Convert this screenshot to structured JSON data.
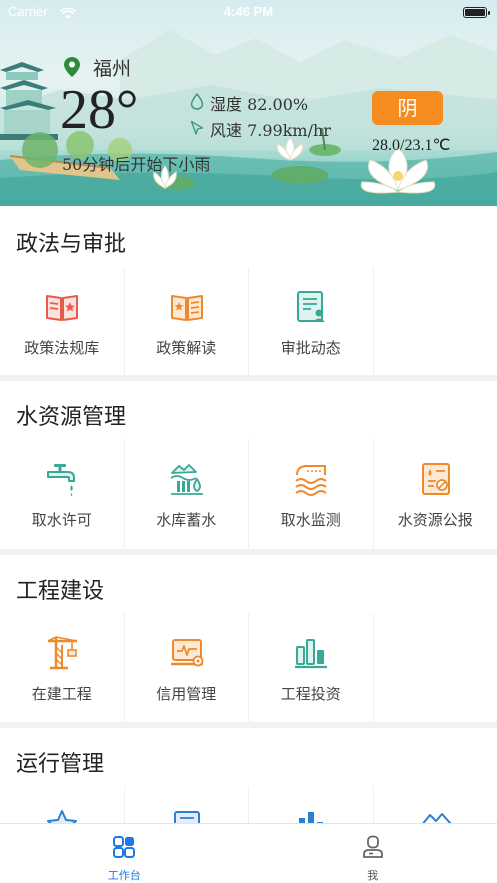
{
  "status_bar": {
    "carrier": "Carrier",
    "time": "4:46 PM"
  },
  "weather": {
    "city": "福州",
    "temperature": "28°",
    "forecast": "50分钟后开始下小雨",
    "humidity": "湿度 82.00%",
    "wind": "风速 7.99km/hr",
    "condition": "阴",
    "range": "28.0/23.1℃",
    "accent_color": "#f58c1f"
  },
  "sections": [
    {
      "title": "政法与审批",
      "items": [
        {
          "label": "政策法规库",
          "icon": "law-book-icon"
        },
        {
          "label": "政策解读",
          "icon": "policy-read-icon"
        },
        {
          "label": "审批动态",
          "icon": "approval-icon"
        }
      ]
    },
    {
      "title": "水资源管理",
      "items": [
        {
          "label": "取水许可",
          "icon": "faucet-icon"
        },
        {
          "label": "水库蓄水",
          "icon": "reservoir-icon"
        },
        {
          "label": "取水监测",
          "icon": "water-monitor-icon"
        },
        {
          "label": "水资源公报",
          "icon": "bulletin-icon"
        }
      ]
    },
    {
      "title": "工程建设",
      "items": [
        {
          "label": "在建工程",
          "icon": "crane-icon"
        },
        {
          "label": "信用管理",
          "icon": "credit-monitor-icon"
        },
        {
          "label": "工程投资",
          "icon": "bar-chart-icon"
        }
      ]
    },
    {
      "title": "运行管理",
      "items": []
    }
  ],
  "tabs": [
    {
      "label": "工作台",
      "active": true,
      "color": "#1e78e6"
    },
    {
      "label": "我",
      "active": false,
      "color": "#555555"
    }
  ]
}
